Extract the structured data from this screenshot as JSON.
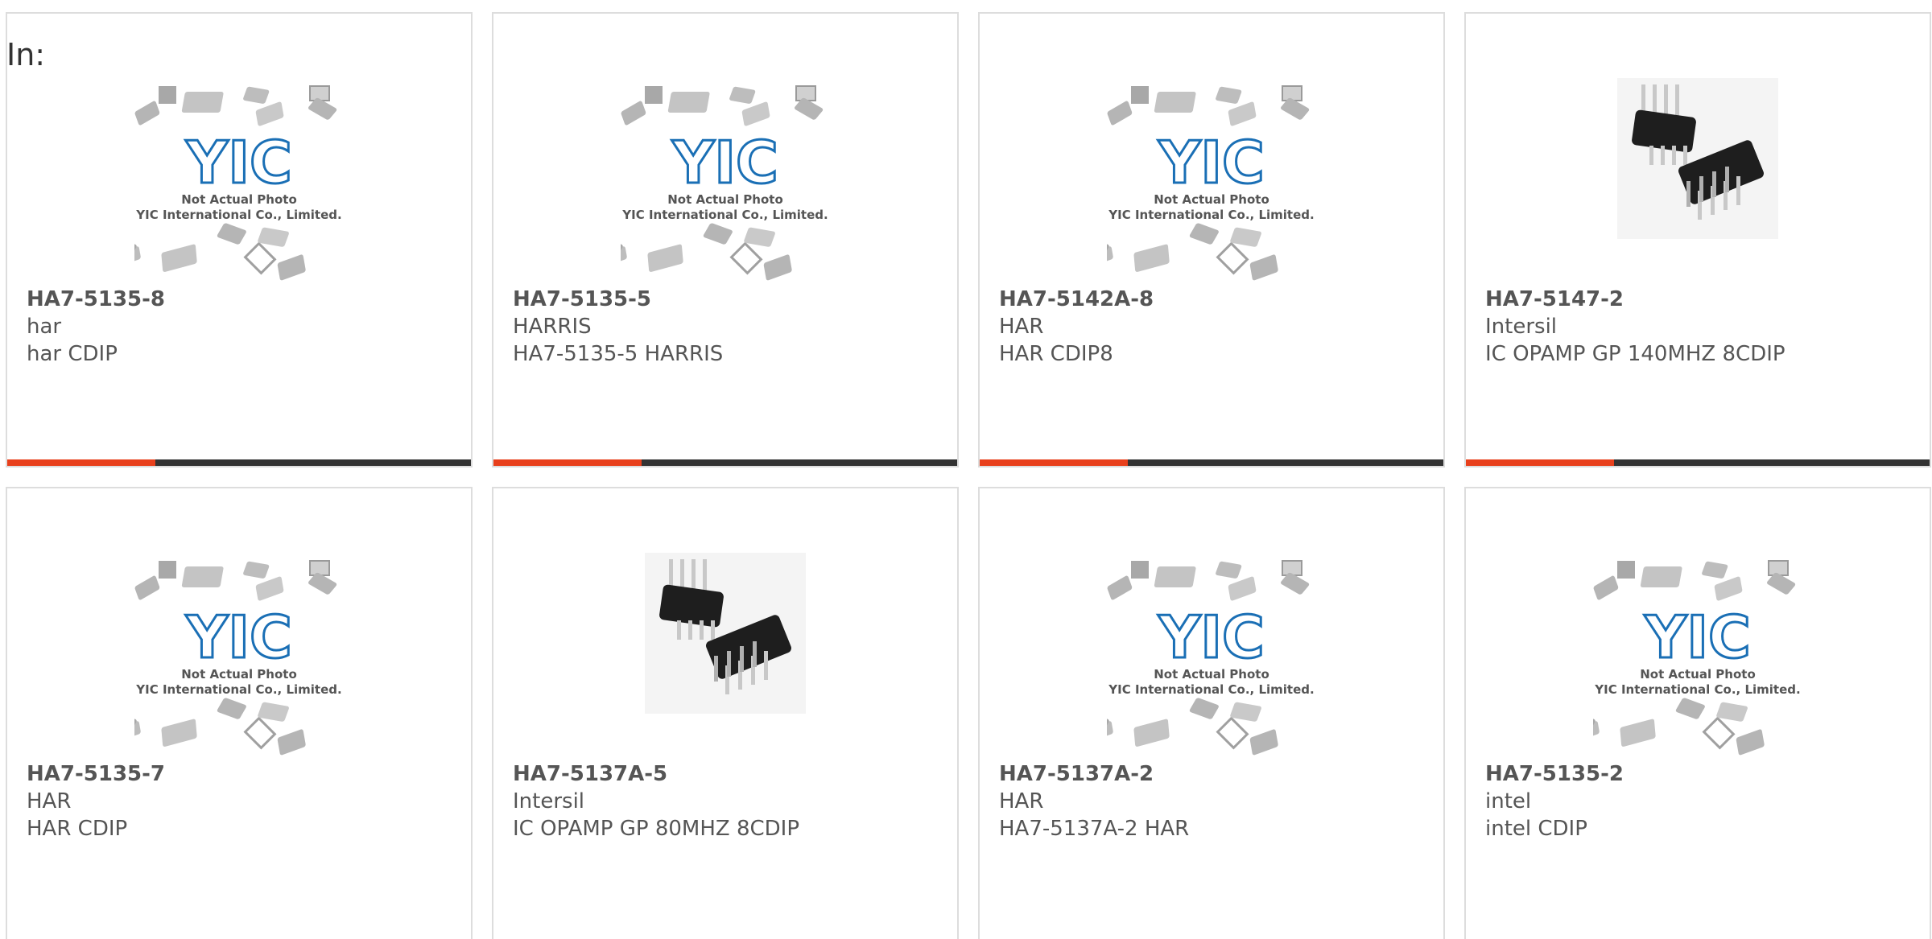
{
  "header": {
    "prefix_label": "In:"
  },
  "placeholder_image": {
    "logo_text": "YIC",
    "line1": "Not Actual Photo",
    "line2": "YIC International Co., Limited."
  },
  "colors": {
    "accent": "#e8401c",
    "bar_track": "#333333",
    "logo_blue": "#1a6fb5",
    "card_border": "#dddddd",
    "text": "#555555"
  },
  "products": [
    {
      "part": "HA7-5135-8",
      "brand": "har",
      "desc": "har CDIP",
      "image": "placeholder-photo",
      "progress": 0.32
    },
    {
      "part": "HA7-5135-5",
      "brand": "HARRIS",
      "desc": "HA7-5135-5 HARRIS",
      "image": "placeholder-photo",
      "progress": 0.32
    },
    {
      "part": "HA7-5142A-8",
      "brand": "HAR",
      "desc": "HAR CDIP8",
      "image": "placeholder-photo",
      "progress": 0.32
    },
    {
      "part": "HA7-5147-2",
      "brand": "Intersil",
      "desc": "IC OPAMP GP 140MHZ 8CDIP",
      "image": "dip-chip-photo",
      "progress": 0.32
    },
    {
      "part": "HA7-5135-7",
      "brand": "HAR",
      "desc": "HAR CDIP",
      "image": "placeholder-photo",
      "progress": null
    },
    {
      "part": "HA7-5137A-5",
      "brand": "Intersil",
      "desc": "IC OPAMP GP 80MHZ 8CDIP",
      "image": "dip-chip-photo",
      "progress": null
    },
    {
      "part": "HA7-5137A-2",
      "brand": "HAR",
      "desc": "HA7-5137A-2 HAR",
      "image": "placeholder-photo",
      "progress": null
    },
    {
      "part": "HA7-5135-2",
      "brand": "intel",
      "desc": "intel CDIP",
      "image": "placeholder-photo",
      "progress": null
    }
  ]
}
